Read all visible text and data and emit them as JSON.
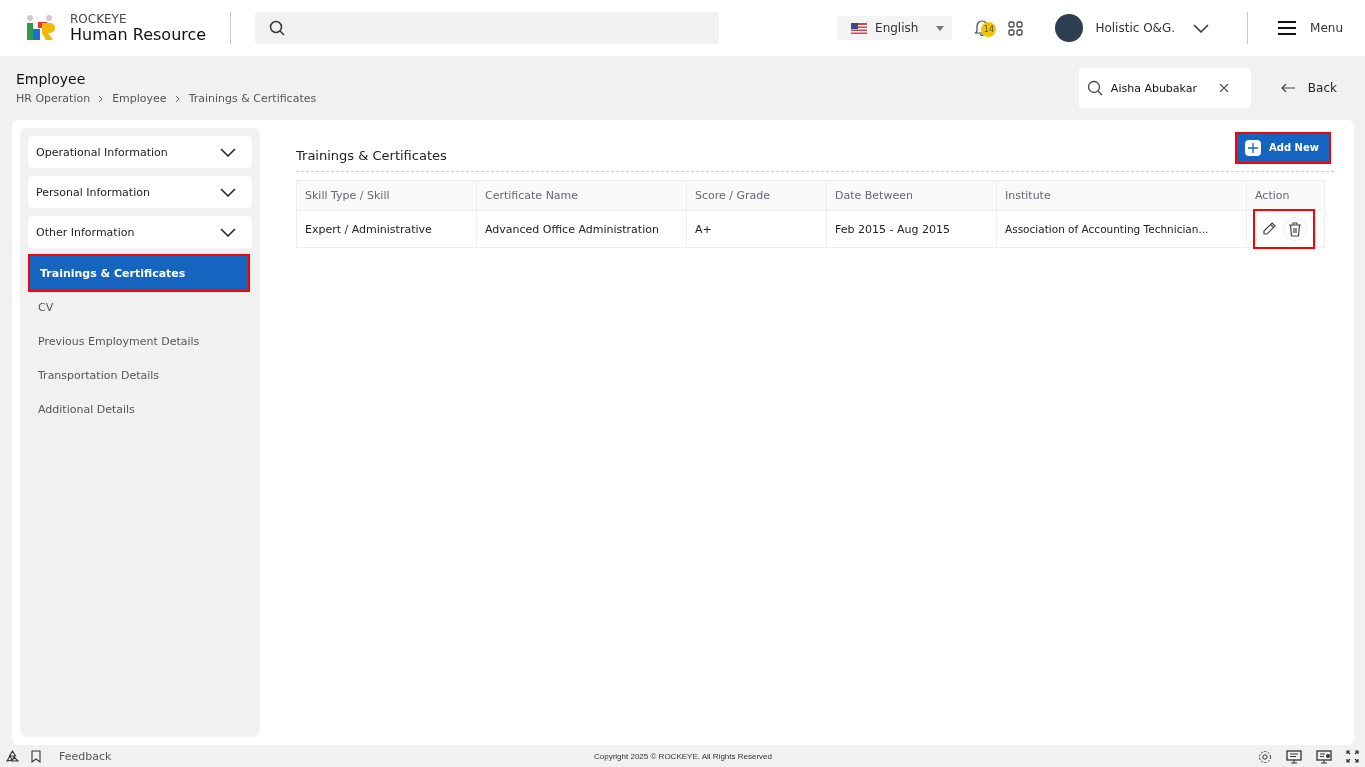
{
  "header": {
    "brand": "ROCKEYE",
    "product": "Human Resource",
    "language": "English",
    "notification_count": "14",
    "user": "Holistic O&G.",
    "menu": "Menu"
  },
  "page": {
    "title": "Employee",
    "breadcrumb": [
      "HR Operation",
      "Employee",
      "Trainings & Certificates"
    ],
    "employee_search": {
      "value": "Aisha Abubakar"
    },
    "back": "Back"
  },
  "sidebar": {
    "sections": [
      {
        "label": "Operational Information"
      },
      {
        "label": "Personal Information"
      },
      {
        "label": "Other Information"
      }
    ],
    "items": [
      {
        "label": "Trainings & Certificates",
        "selected": true,
        "highlighted": true
      },
      {
        "label": "CV",
        "selected": false,
        "highlighted": false
      },
      {
        "label": "Previous Employment Details",
        "selected": false,
        "highlighted": false
      },
      {
        "label": "Transportation Details",
        "selected": false,
        "highlighted": false
      },
      {
        "label": "Additional Details",
        "selected": false,
        "highlighted": false
      }
    ]
  },
  "content": {
    "title": "Trainings & Certificates",
    "add_button": {
      "label": "Add New",
      "highlighted": true
    },
    "table": {
      "columns": [
        "Skill Type / Skill",
        "Certificate Name",
        "Score / Grade",
        "Date Between",
        "Institute",
        "Action"
      ],
      "rows": [
        {
          "cells": [
            "Expert / Administrative",
            "Advanced Office Administration",
            "A+",
            "Feb 2015 - Aug 2015",
            "Association of Accounting Technician..."
          ],
          "actions_highlighted": true
        }
      ]
    }
  },
  "footer": {
    "feedback": "Feedback",
    "copyright": "Copyright 2025 © ROCKEYE. All Rights Reserved"
  }
}
